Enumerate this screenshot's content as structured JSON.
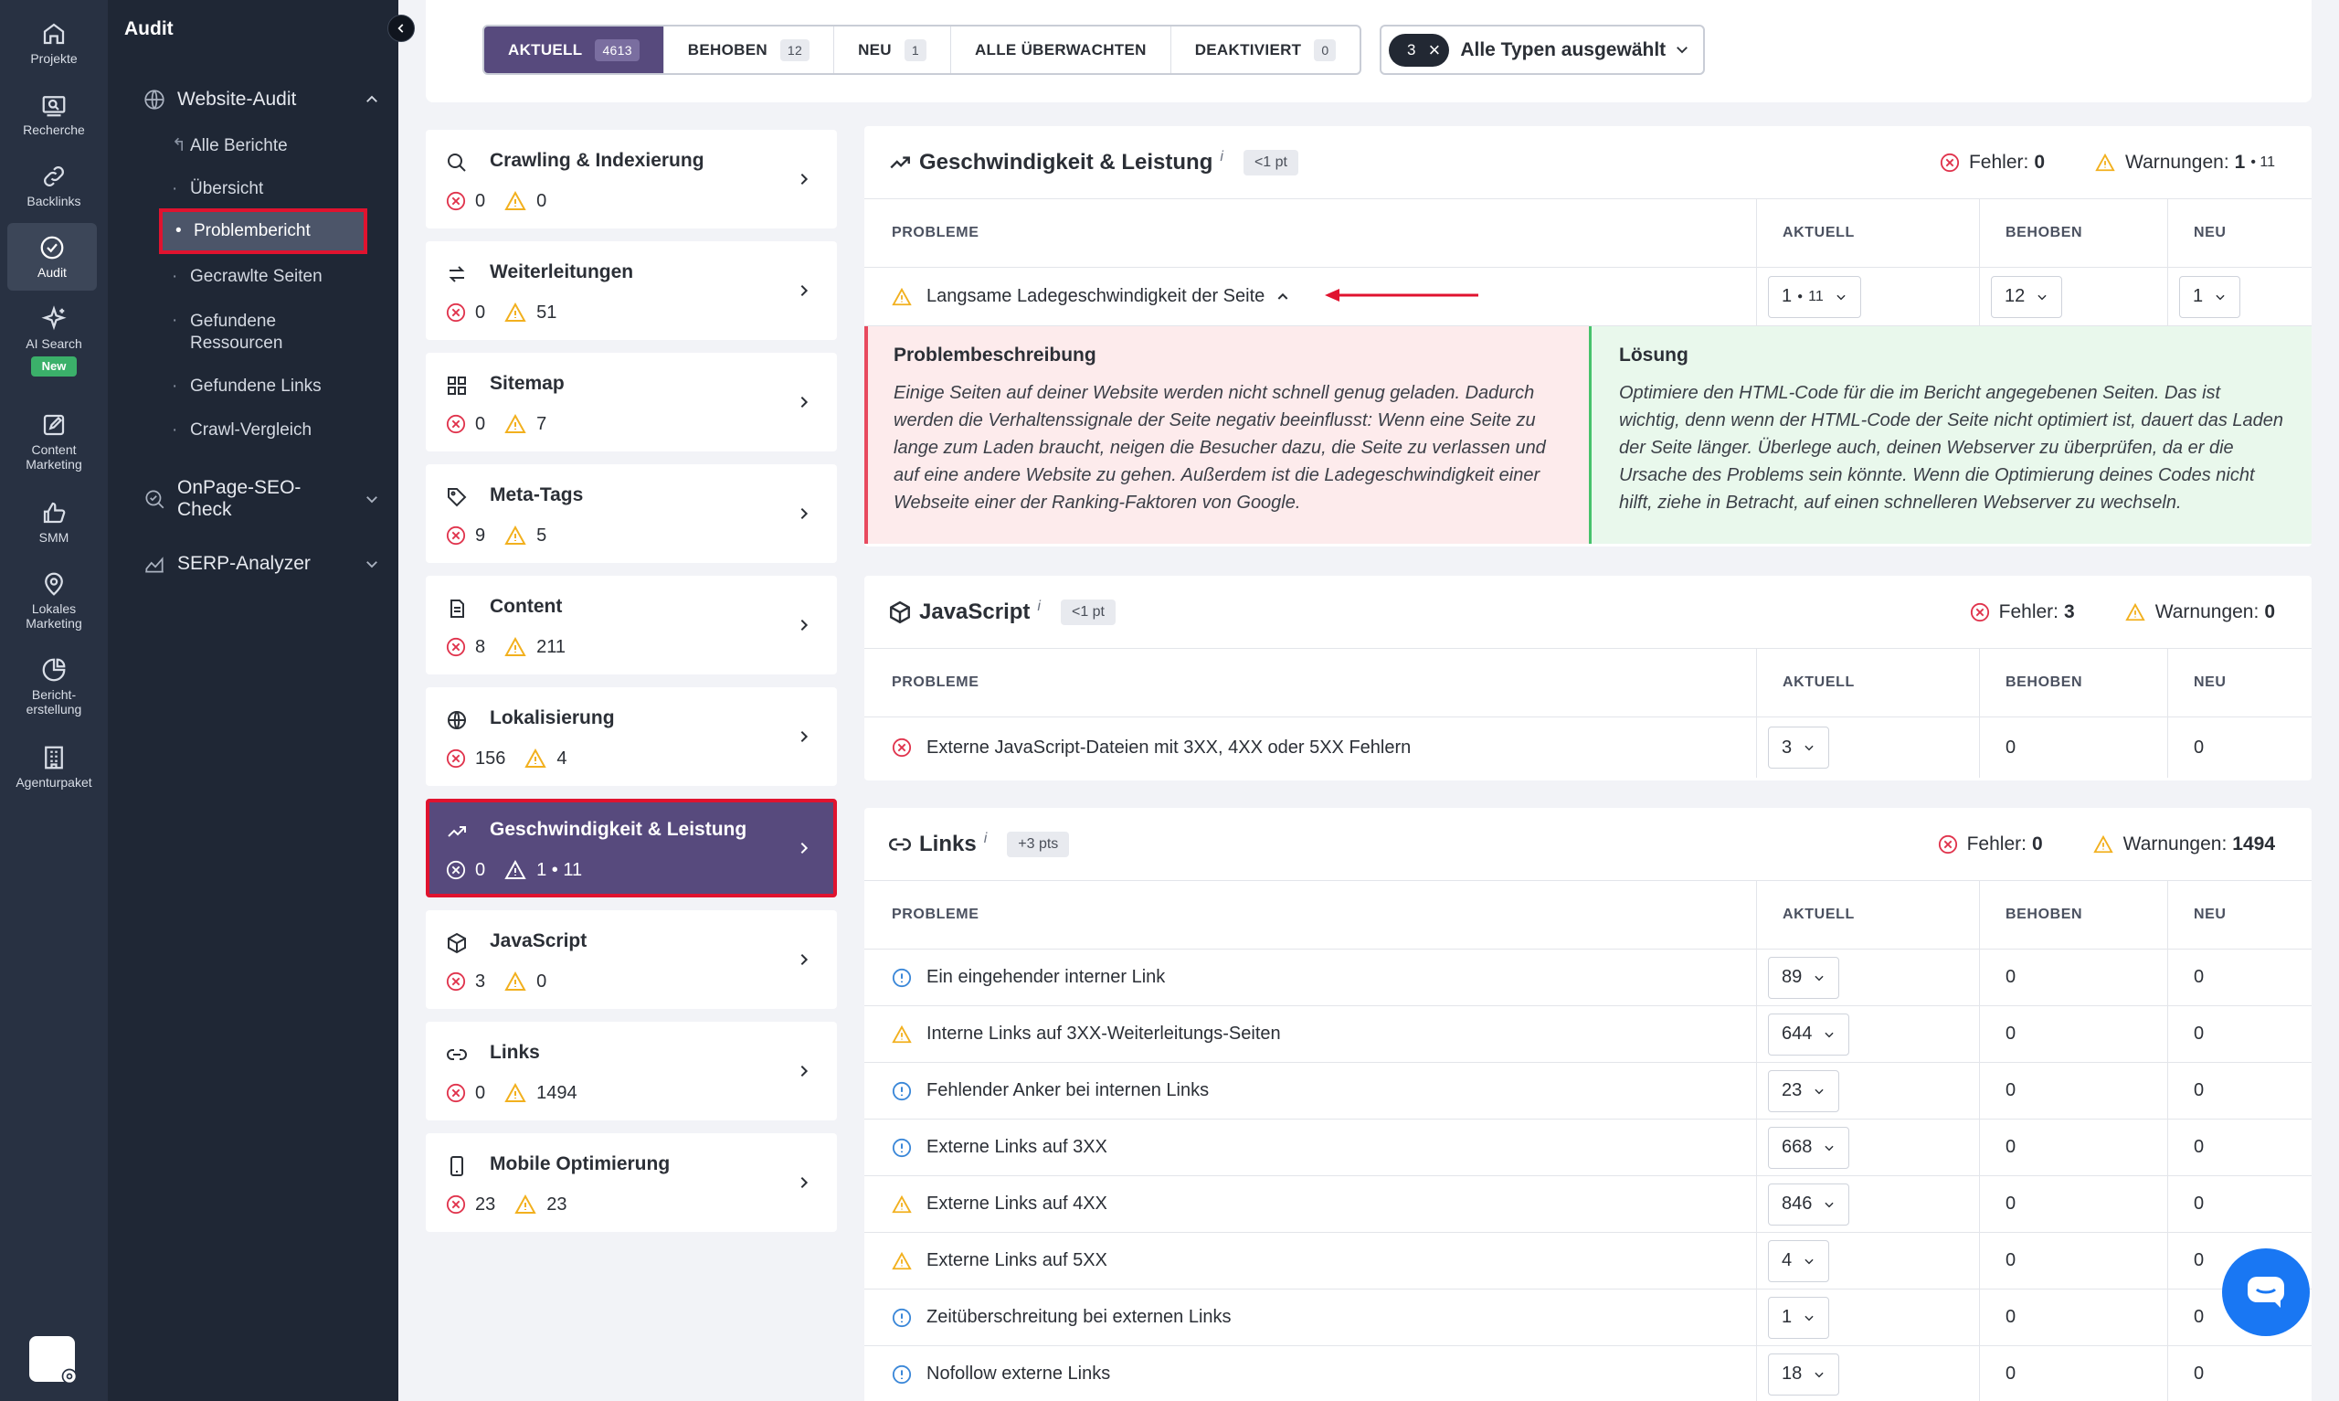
{
  "rail": [
    {
      "key": "projekte",
      "label": "Projekte"
    },
    {
      "key": "recherche",
      "label": "Recherche"
    },
    {
      "key": "backlinks",
      "label": "Backlinks"
    },
    {
      "key": "audit",
      "label": "Audit"
    },
    {
      "key": "ai",
      "label": "AI Search",
      "badge": "New"
    },
    {
      "key": "content",
      "label": "Content Marketing"
    },
    {
      "key": "smm",
      "label": "SMM"
    },
    {
      "key": "lokal",
      "label": "Lokales Marketing"
    },
    {
      "key": "bericht",
      "label": "Bericht-erstellung"
    },
    {
      "key": "agentur",
      "label": "Agenturpaket"
    }
  ],
  "subnav": {
    "title": "Audit",
    "groups": [
      {
        "label": "Website-Audit"
      },
      {
        "label": "OnPage-SEO-Check"
      },
      {
        "label": "SERP-Analyzer"
      }
    ],
    "items": [
      "Alle Berichte",
      "Übersicht",
      "Problembericht",
      "Gecrawlte Seiten",
      "Gefundene Ressourcen",
      "Gefundene Links",
      "Crawl-Vergleich"
    ]
  },
  "filters": {
    "tabs": [
      {
        "label": "AKTUELL",
        "count": "4613"
      },
      {
        "label": "BEHOBEN",
        "count": "12"
      },
      {
        "label": "NEU",
        "count": "1"
      },
      {
        "label": "ALLE ÜBERWACHTEN",
        "count": ""
      },
      {
        "label": "DEAKTIVIERT",
        "count": "0"
      }
    ],
    "types_count": "3",
    "types_label": "Alle Typen ausgewählt"
  },
  "categories": [
    {
      "title": "Crawling & Indexierung",
      "errors": "0",
      "warnings": "0"
    },
    {
      "title": "Weiterleitungen",
      "errors": "0",
      "warnings": "51"
    },
    {
      "title": "Sitemap",
      "errors": "0",
      "warnings": "7"
    },
    {
      "title": "Meta-Tags",
      "errors": "9",
      "warnings": "5"
    },
    {
      "title": "Content",
      "errors": "8",
      "warnings": "211"
    },
    {
      "title": "Lokalisierung",
      "errors": "156",
      "warnings": "4"
    },
    {
      "title": "Geschwindigkeit & Leistung",
      "errors": "0",
      "warnings": "1 • 11"
    },
    {
      "title": "JavaScript",
      "errors": "3",
      "warnings": "0"
    },
    {
      "title": "Links",
      "errors": "0",
      "warnings": "1494"
    },
    {
      "title": "Mobile Optimierung",
      "errors": "23",
      "warnings": "23"
    }
  ],
  "columns": {
    "problems": "PROBLEME",
    "current": "AKTUELL",
    "fixed": "BEHOBEN",
    "new": "NEU"
  },
  "speed": {
    "title": "Geschwindigkeit & Leistung",
    "info": "i",
    "pts": "<1 pt",
    "errors_label": "Fehler:",
    "errors": "0",
    "warnings_label": "Warnungen:",
    "warnings": "1",
    "warnings_extra": "• 11",
    "issue": "Langsame Ladegeschwindigkeit der Seite",
    "current_main": "1",
    "current_extra": "11",
    "fixed": "12",
    "new": "1",
    "desc_title": "Problembeschreibung",
    "desc_text": "Einige Seiten auf deiner Website werden nicht schnell genug geladen. Dadurch werden die Verhaltenssignale der Seite negativ beeinflusst: Wenn eine Seite zu lange zum Laden braucht, neigen die Besucher dazu, die Seite zu verlassen und auf eine andere Website zu gehen. Außerdem ist die Ladegeschwindigkeit einer Webseite einer der Ranking-Faktoren von Google.",
    "sol_title": "Lösung",
    "sol_text": "Optimiere den HTML-Code für die im Bericht angegebenen Seiten. Das ist wichtig, denn wenn der HTML-Code der Seite nicht optimiert ist, dauert das Laden der Seite länger. Überlege auch, deinen Webserver zu überprüfen, da er die Ursache des Problems sein könnte. Wenn die Optimierung deines Codes nicht hilft, ziehe in Betracht, auf einen schnelleren Webserver zu wechseln."
  },
  "js": {
    "title": "JavaScript",
    "info": "i",
    "pts": "<1 pt",
    "errors_label": "Fehler:",
    "errors": "3",
    "warnings_label": "Warnungen:",
    "warnings": "0",
    "rows": [
      {
        "type": "error",
        "label": "Externe JavaScript-Dateien mit 3XX, 4XX oder 5XX Fehlern",
        "current": "3",
        "fixed": "0",
        "new": "0"
      }
    ]
  },
  "links": {
    "title": "Links",
    "info": "i",
    "pts": "+3 pts",
    "errors_label": "Fehler:",
    "errors": "0",
    "warnings_label": "Warnungen:",
    "warnings": "1494",
    "rows": [
      {
        "type": "notice",
        "label": "Ein eingehender interner Link",
        "current": "89",
        "fixed": "0",
        "new": "0"
      },
      {
        "type": "warning",
        "label": "Interne Links auf 3XX-Weiterleitungs-Seiten",
        "current": "644",
        "fixed": "0",
        "new": "0"
      },
      {
        "type": "notice",
        "label": "Fehlender Anker bei internen Links",
        "current": "23",
        "fixed": "0",
        "new": "0"
      },
      {
        "type": "notice",
        "label": "Externe Links auf 3XX",
        "current": "668",
        "fixed": "0",
        "new": "0"
      },
      {
        "type": "warning",
        "label": "Externe Links auf 4XX",
        "current": "846",
        "fixed": "0",
        "new": "0"
      },
      {
        "type": "warning",
        "label": "Externe Links auf 5XX",
        "current": "4",
        "fixed": "0",
        "new": "0"
      },
      {
        "type": "notice",
        "label": "Zeitüberschreitung bei externen Links",
        "current": "1",
        "fixed": "0",
        "new": "0"
      },
      {
        "type": "notice",
        "label": "Nofollow externe Links",
        "current": "18",
        "fixed": "0",
        "new": "0"
      }
    ]
  },
  "colors": {
    "accent": "#574a7d",
    "highlight": "#e0132f",
    "error": "#e0334c",
    "warning": "#f2b01e",
    "notice": "#3a87d8",
    "chat": "#1977f3"
  }
}
